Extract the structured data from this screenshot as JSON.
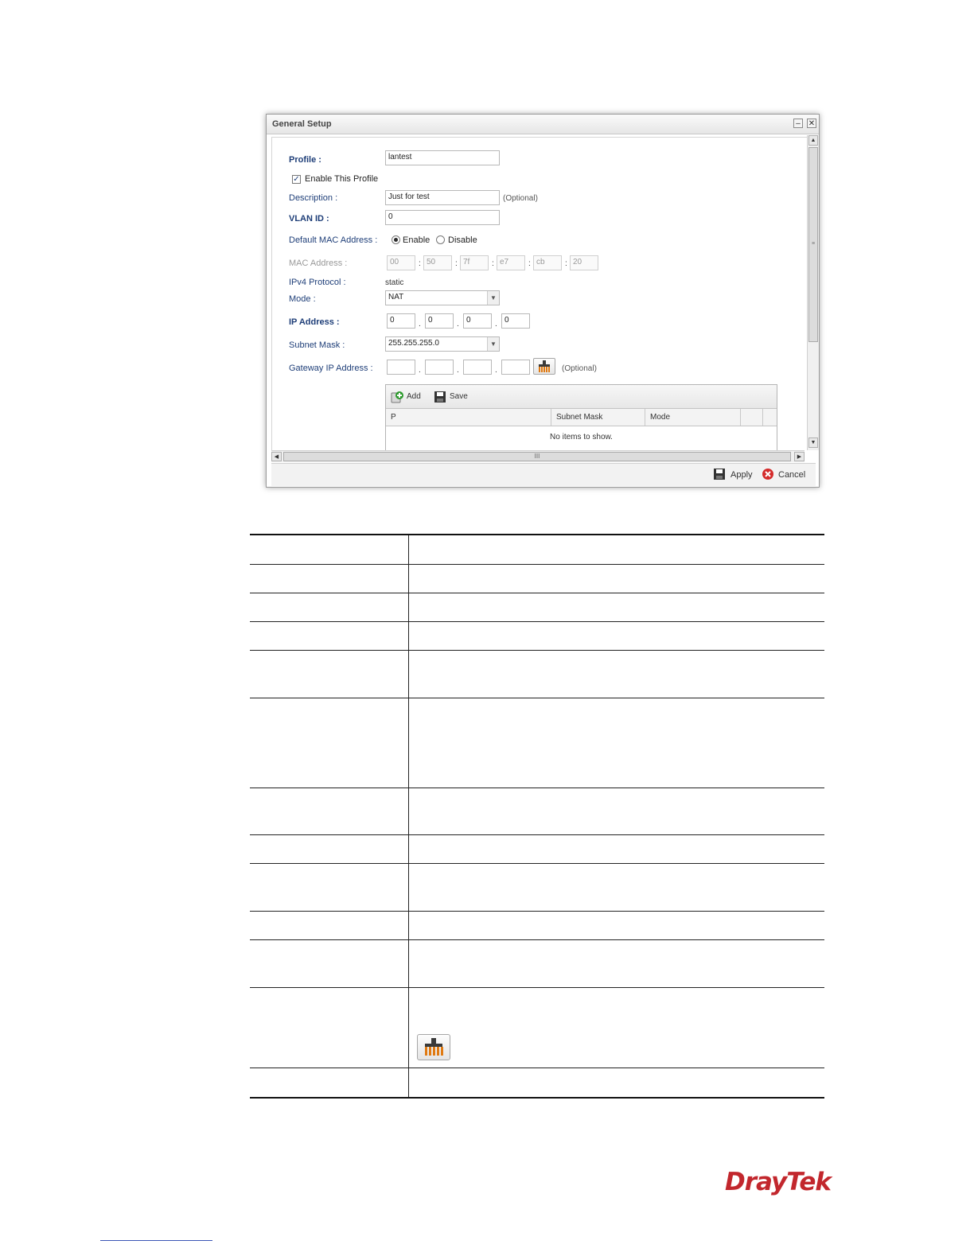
{
  "dialog": {
    "title": "General Setup",
    "minimize_glyph": "–",
    "close_glyph": "✕"
  },
  "form": {
    "profile_label": "Profile :",
    "profile_value": "lantest",
    "enable_label": "Enable This Profile",
    "enable_checked": true,
    "description_label": "Description :",
    "description_value": "Just for test",
    "optional_text": "(Optional)",
    "vlan_label": "VLAN ID :",
    "vlan_value": "0",
    "default_mac_label": "Default MAC Address :",
    "enable_option": "Enable",
    "disable_option": "Disable",
    "default_mac_selected": "Enable",
    "mac_label": "MAC Address :",
    "mac_octets": [
      "00",
      "50",
      "7f",
      "e7",
      "cb",
      "20"
    ],
    "ipv4_label": "IPv4 Protocol :",
    "ipv4_value": "static",
    "mode_label": "Mode :",
    "mode_value": "NAT",
    "ip_label": "IP Address :",
    "ip_octets": [
      "0",
      "0",
      "0",
      "0"
    ],
    "subnet_label": "Subnet Mask :",
    "subnet_value": "255.255.255.0",
    "gateway_label": "Gateway IP Address :",
    "gateway_octets": [
      "",
      "",
      "",
      ""
    ],
    "gateway_optional": "(Optional)"
  },
  "grid": {
    "add_label": "Add",
    "save_label": "Save",
    "columns": [
      "P",
      "Subnet Mask",
      "Mode"
    ],
    "empty_text": "No items to show."
  },
  "scroll": {
    "hscroll_grip": "III",
    "vscroll_grip": "≡"
  },
  "footer": {
    "apply_label": "Apply",
    "cancel_label": "Cancel"
  },
  "description_table": {
    "row_count": 13
  },
  "brand": {
    "logo_text": "DrayTek",
    "logo_color": "#c2272d"
  }
}
